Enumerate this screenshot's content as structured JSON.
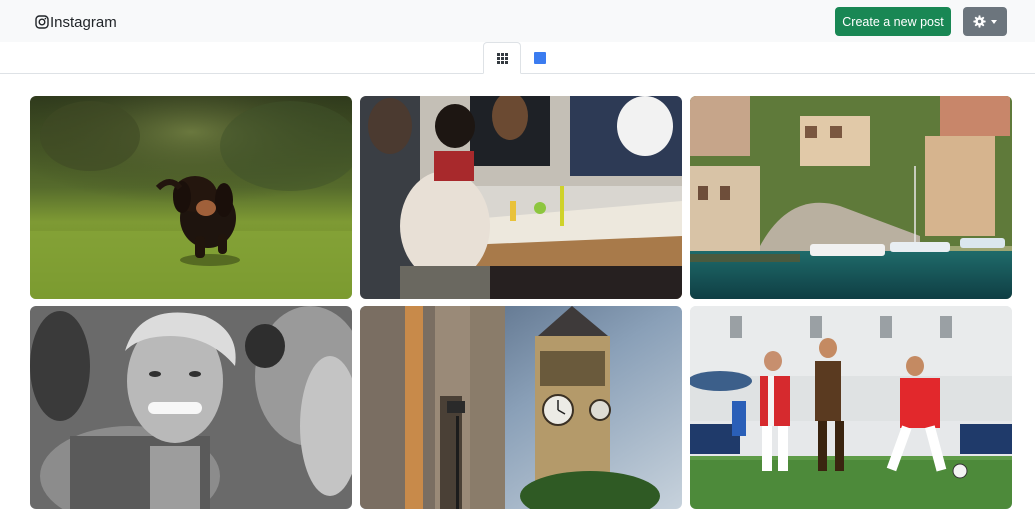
{
  "app": {
    "brand_label": "Instagram",
    "brand_icon": "instagram-icon"
  },
  "header": {
    "create_post_label": "Create a new post",
    "settings_icon": "gear-icon"
  },
  "tabs": [
    {
      "id": "grid",
      "icon": "grid-icon",
      "active": true
    },
    {
      "id": "single",
      "icon": "square-icon",
      "active": false
    }
  ],
  "posts": [
    {
      "subject": "puppy running on grass"
    },
    {
      "subject": "students working at a table"
    },
    {
      "subject": "harbour with boats and houses"
    },
    {
      "subject": "smiling woman in crowd, black and white"
    },
    {
      "subject": "big ben clock tower"
    },
    {
      "subject": "football players on pitch"
    }
  ],
  "colors": {
    "create_button": "#198754",
    "settings_button": "#6c757d",
    "active_view": "#3b7cf0",
    "navbar_bg": "#f8f9fa"
  }
}
